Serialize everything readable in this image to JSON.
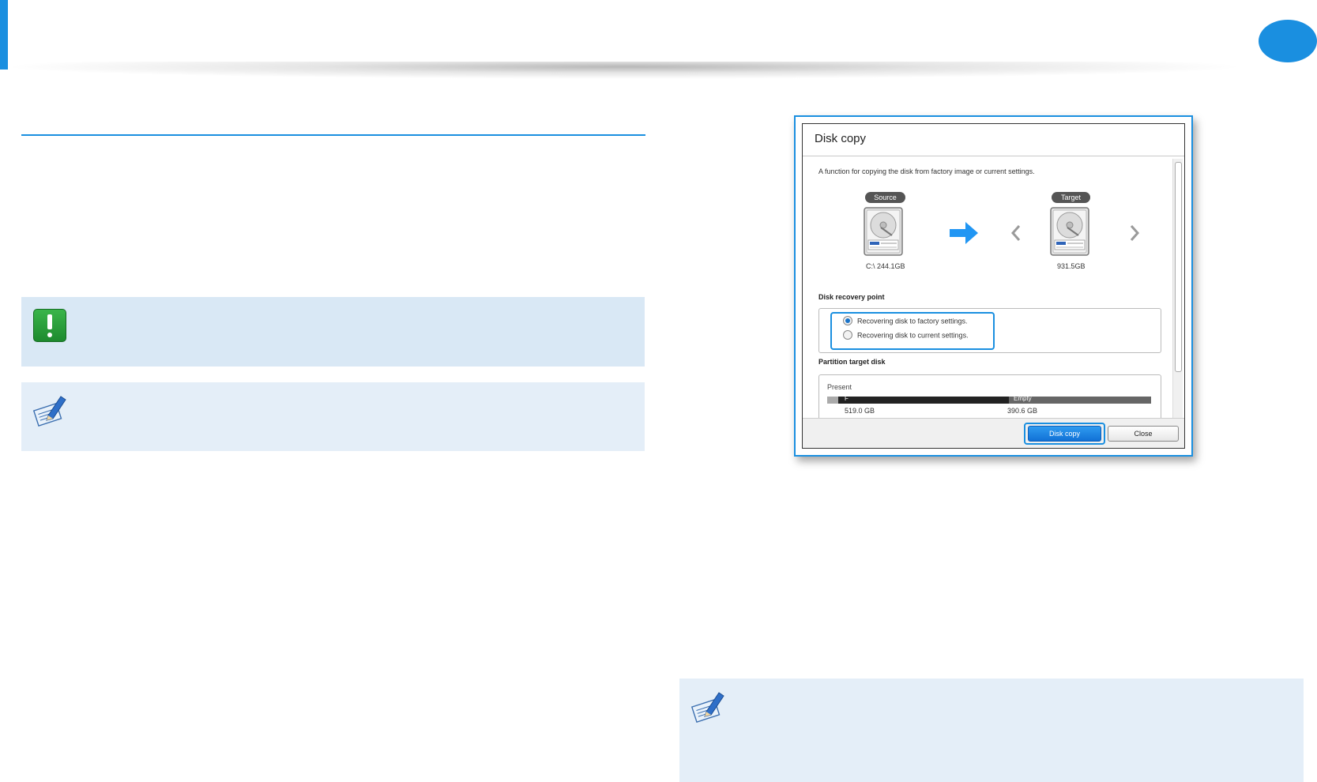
{
  "colors": {
    "accent": "#1a8fe0",
    "notice_bg": "#d9e8f5",
    "note_bg": "#e4eef8",
    "caution_green": "#2e9e3e"
  },
  "page": {
    "header_icon": "page-number-circle",
    "caution_icon": "exclamation-icon",
    "note_icon": "pencil-note-icon"
  },
  "dialog": {
    "title": "Disk copy",
    "description": "A function for copying the disk from factory image or current settings.",
    "source": {
      "badge": "Source",
      "size_label": "C:\\ 244.1GB",
      "icon": "hard-disk-icon"
    },
    "target": {
      "badge": "Target",
      "size_label": "931.5GB",
      "icon": "hard-disk-icon"
    },
    "recovery_point": {
      "label": "Disk recovery point",
      "options": [
        {
          "label": "Recovering disk to factory settings.",
          "selected": true
        },
        {
          "label": "Recovering disk to current settings.",
          "selected": false
        }
      ]
    },
    "partition": {
      "label": "Partition target disk",
      "present_label": "Present",
      "segments": [
        {
          "label": "F",
          "size": "519.0 GB"
        },
        {
          "label": "Empty",
          "size": "390.6 GB"
        }
      ]
    },
    "buttons": {
      "copy": "Disk copy",
      "close": "Close"
    }
  }
}
